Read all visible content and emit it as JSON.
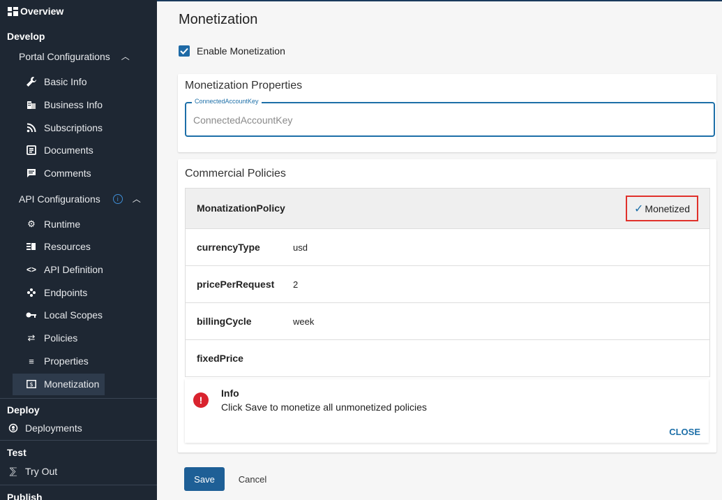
{
  "sidebar": {
    "overview": "Overview",
    "sections": {
      "develop": "Develop",
      "deploy": "Deploy",
      "test": "Test",
      "publish": "Publish"
    },
    "portal_configurations": "Portal Configurations",
    "portal_items": [
      {
        "label": "Basic Info",
        "icon": "wrench-icon"
      },
      {
        "label": "Business Info",
        "icon": "business-icon"
      },
      {
        "label": "Subscriptions",
        "icon": "rss-icon"
      },
      {
        "label": "Documents",
        "icon": "document-icon"
      },
      {
        "label": "Comments",
        "icon": "comment-icon"
      }
    ],
    "api_configurations": "API Configurations",
    "api_items": [
      {
        "label": "Runtime",
        "icon": "gear-icon"
      },
      {
        "label": "Resources",
        "icon": "resources-icon"
      },
      {
        "label": "API Definition",
        "icon": "code-icon"
      },
      {
        "label": "Endpoints",
        "icon": "endpoints-icon"
      },
      {
        "label": "Local Scopes",
        "icon": "key-icon"
      },
      {
        "label": "Policies",
        "icon": "swap-icon"
      },
      {
        "label": "Properties",
        "icon": "list-icon"
      },
      {
        "label": "Monetization",
        "icon": "money-icon"
      }
    ],
    "deployments": "Deployments",
    "try_out": "Try Out"
  },
  "main": {
    "title": "Monetization",
    "enable_label": "Enable Monetization",
    "enable_checked": true,
    "properties_card": {
      "title": "Monetization Properties",
      "field_legend": "ConnectedAccountKey",
      "field_placeholder": "ConnectedAccountKey"
    },
    "policies_card": {
      "title": "Commercial Policies",
      "policy_name": "MonatizationPolicy",
      "status": "Monetized",
      "rows": [
        {
          "key": "currencyType",
          "value": "usd"
        },
        {
          "key": "pricePerRequest",
          "value": "2"
        },
        {
          "key": "billingCycle",
          "value": "week"
        },
        {
          "key": "fixedPrice",
          "value": ""
        }
      ],
      "info": {
        "title": "Info",
        "text": "Click Save to monetize all unmonetized policies",
        "close": "CLOSE"
      }
    },
    "save_label": "Save",
    "cancel_label": "Cancel"
  },
  "colors": {
    "sidebar_bg": "#1e2733",
    "accent": "#1d6fa8",
    "highlight": "#e0312b",
    "error": "#d9232e"
  }
}
